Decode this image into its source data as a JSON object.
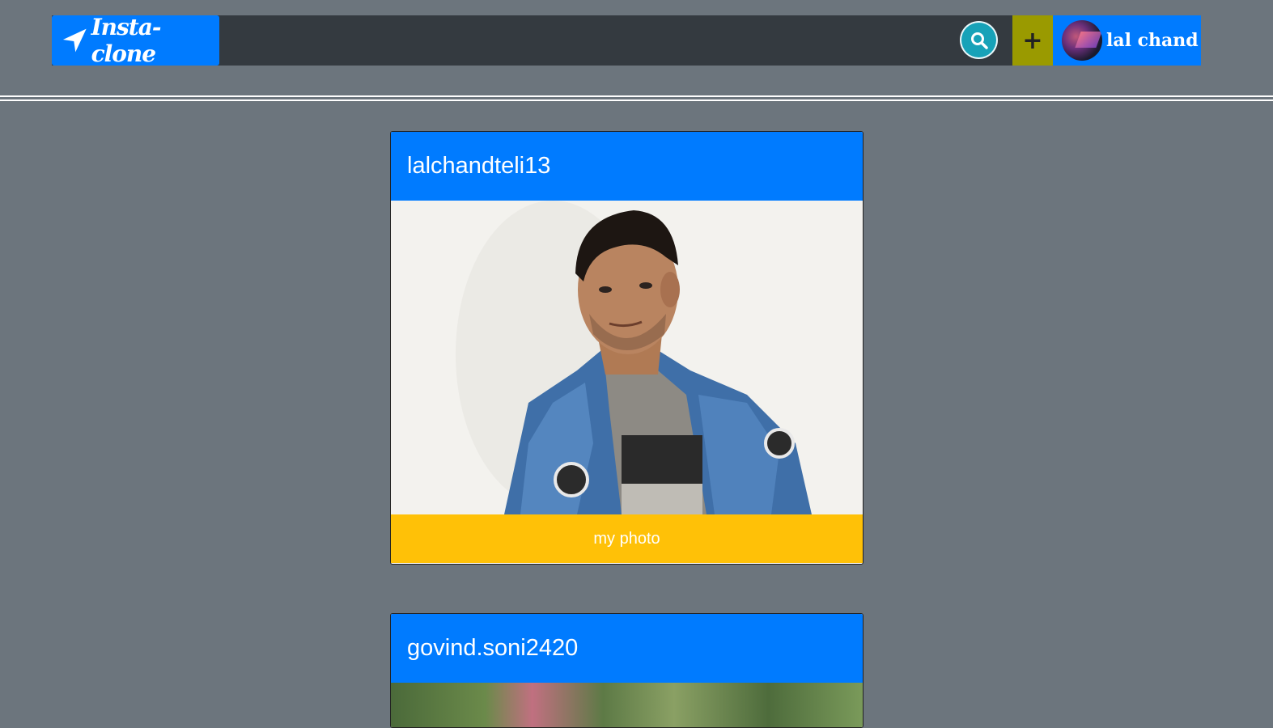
{
  "navbar": {
    "brand": "Insta-clone",
    "add_label": "+",
    "user_name": "lal chand"
  },
  "posts": [
    {
      "username": "lalchandteli13",
      "caption": "my photo"
    },
    {
      "username": "govind.soni2420"
    }
  ],
  "colors": {
    "page_bg": "#6c757d",
    "navbar_bg": "#343a40",
    "primary": "#007bff",
    "search": "#17a2b8",
    "add": "#9a9a00",
    "caption_bg": "#ffc107"
  }
}
